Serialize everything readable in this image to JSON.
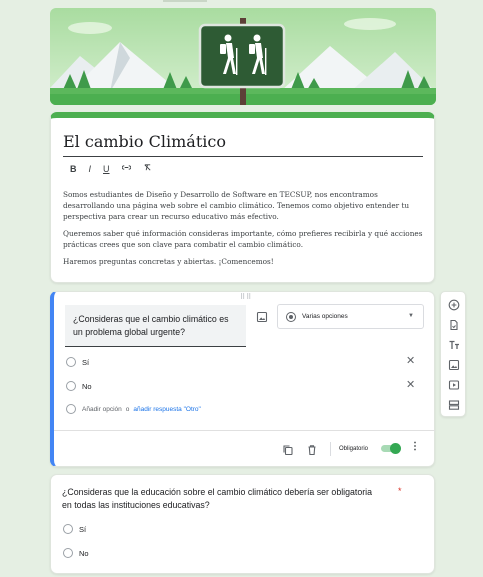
{
  "form": {
    "title": "El cambio Climático",
    "toolbar": {
      "bold": "B",
      "italic": "I",
      "underline": "U",
      "link": "⊖",
      "clear": "⊼"
    },
    "description": [
      "Somos estudiantes de Diseño y Desarrollo de Software en TECSUP, nos encontramos desarrollando  una página web sobre el cambio climático. Tenemos como objetivo entender tu perspectiva para crear un recurso educativo más efectivo.",
      "Queremos saber qué información consideras importante, cómo prefieres recibirla y qué acciones prácticas crees que son clave para combatir el cambio climático.",
      "Haremos preguntas concretas y abiertas. ¡Comencemos!"
    ]
  },
  "question1": {
    "text": "¿Consideras que el cambio climático es un problema global urgente?",
    "type_label": "Varias opciones",
    "options": [
      "Sí",
      "No"
    ],
    "add_option": "Añadir opción",
    "or": "o",
    "add_other": "añadir respuesta \"Otro\"",
    "required_label": "Obligatorio",
    "required": true
  },
  "question2": {
    "text": "¿Consideras que la educación sobre el cambio climático debería ser obligatoria en todas las instituciones educativas?",
    "required_marker": "*",
    "options": [
      "Sí",
      "No"
    ]
  },
  "side_toolbar": {
    "items": [
      "add-question-icon",
      "import-questions-icon",
      "add-title-icon",
      "add-image-icon",
      "add-video-icon",
      "add-section-icon"
    ]
  },
  "colors": {
    "accent": "#4caf50",
    "active_border": "#4285f4",
    "toggle_on": "#34a853",
    "required_star": "#d93025",
    "link": "#1a73e8"
  }
}
